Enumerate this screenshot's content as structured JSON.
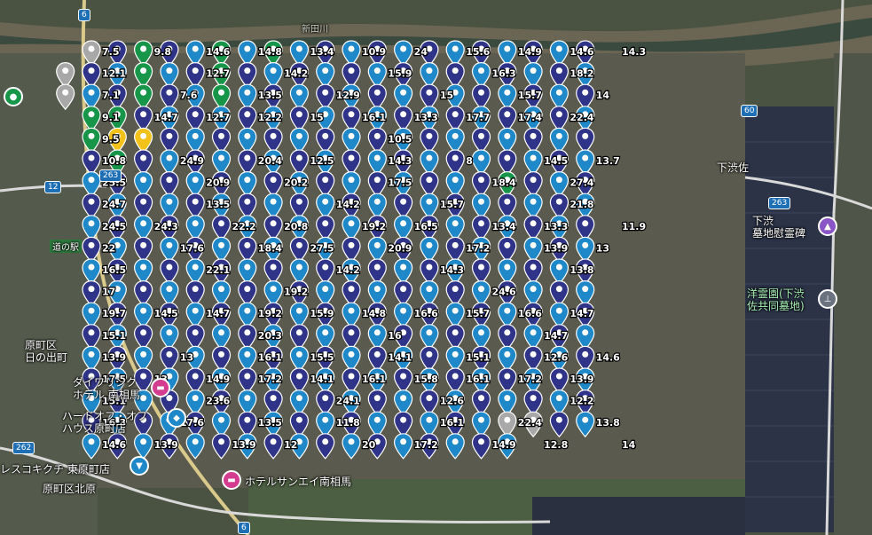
{
  "colors": {
    "pin_blue": "#1e88c8",
    "pin_navy": "#303489",
    "pin_green": "#17964a",
    "pin_gray": "#a8a8a8",
    "pin_yellow": "#f2c21b"
  },
  "map_labels": {
    "river": "新田川",
    "hotel_dairing": "ダイワリンク\nホテル 南相馬",
    "hardoff": "ハードオフ・オフ\nハウス原町店",
    "hotel_sanei": "ホテルサンエイ南相馬",
    "haramachi_hinode": "原町区\n日の出町",
    "haramachi_kitahara": "原町区北原",
    "michinoeki": "道の駅",
    "shimoshibusa_cemetery": "洋霊園(下渋\n佐共同墓地)",
    "shimoshibusa_memorial": "下渋\n墓地慰霊碑",
    "shimoshibusa_town": "下渋佐",
    "store_kuchi": "レスコキクチ 東原町店"
  },
  "road_shields": [
    "6",
    "12",
    "263",
    "262",
    "6",
    "263",
    "60"
  ],
  "pin_values": {
    "row0": [
      "7.5",
      "9.8",
      "14.6",
      "14.8",
      "13.4",
      "10.9",
      "24",
      "15.6",
      "14.9",
      "14.6",
      "14.3"
    ],
    "row1": [
      "12.1",
      "12.7",
      "14.2",
      "15.9",
      "16.3",
      "18.2"
    ],
    "row2": [
      "7.1",
      "7.6",
      "13.5",
      "12.9",
      "15",
      "15.7",
      "14"
    ],
    "row3": [
      "9.1",
      "14.7",
      "12.7",
      "12.2",
      "15",
      "16.1",
      "13.3",
      "17.7",
      "17.4",
      "22.4"
    ],
    "row4": [
      "9.5",
      "10.5"
    ],
    "row5": [
      "10.8",
      "24.9",
      "20.4",
      "12.5",
      "14.3",
      "8",
      "14.5",
      "13.7"
    ],
    "row6": [
      "25.5",
      "20.9",
      "20.2",
      "17.5",
      "18.4",
      "27.4"
    ],
    "row7": [
      "24.7",
      "13.5",
      "14.2",
      "15.7",
      "21.8"
    ],
    "row8": [
      "24.5",
      "24.3",
      "22.2",
      "20.8",
      "19.2",
      "16.5",
      "13.4",
      "13.3",
      "11.9"
    ],
    "row9": [
      "22",
      "17.6",
      "18.4",
      "27.5",
      "20.9",
      "17.2",
      "13.9",
      "13"
    ],
    "row10": [
      "16.5",
      "22.1",
      "14.2",
      "14.3",
      "13.8"
    ],
    "row11": [
      "17",
      "19.2",
      "24.6"
    ],
    "row12": [
      "19.7",
      "14.5",
      "14.7",
      "19.2",
      "15.9",
      "14.8",
      "16.6",
      "15.7",
      "16.6",
      "14.7"
    ],
    "row13": [
      "15.1",
      "20.3",
      "16",
      "14.7"
    ],
    "row14": [
      "13.9",
      "13",
      "16.1",
      "15.5",
      "14.1",
      "15.1",
      "12.6",
      "14.6"
    ],
    "row15": [
      "17.5",
      "13",
      "14.9",
      "17.2",
      "14.1",
      "16.1",
      "15.8",
      "16.1",
      "17.2",
      "13.9"
    ],
    "row16": [
      "15.1",
      "23.6",
      "24.1",
      "12.6",
      "12.2"
    ],
    "row17": [
      "16.3",
      "17.6",
      "13.5",
      "11.8",
      "16.1",
      "22.4",
      "13.8"
    ],
    "row18": [
      "14.6",
      "13.9",
      "13.9",
      "12",
      "20",
      "17.2",
      "14.9",
      "12.8",
      "14"
    ]
  }
}
